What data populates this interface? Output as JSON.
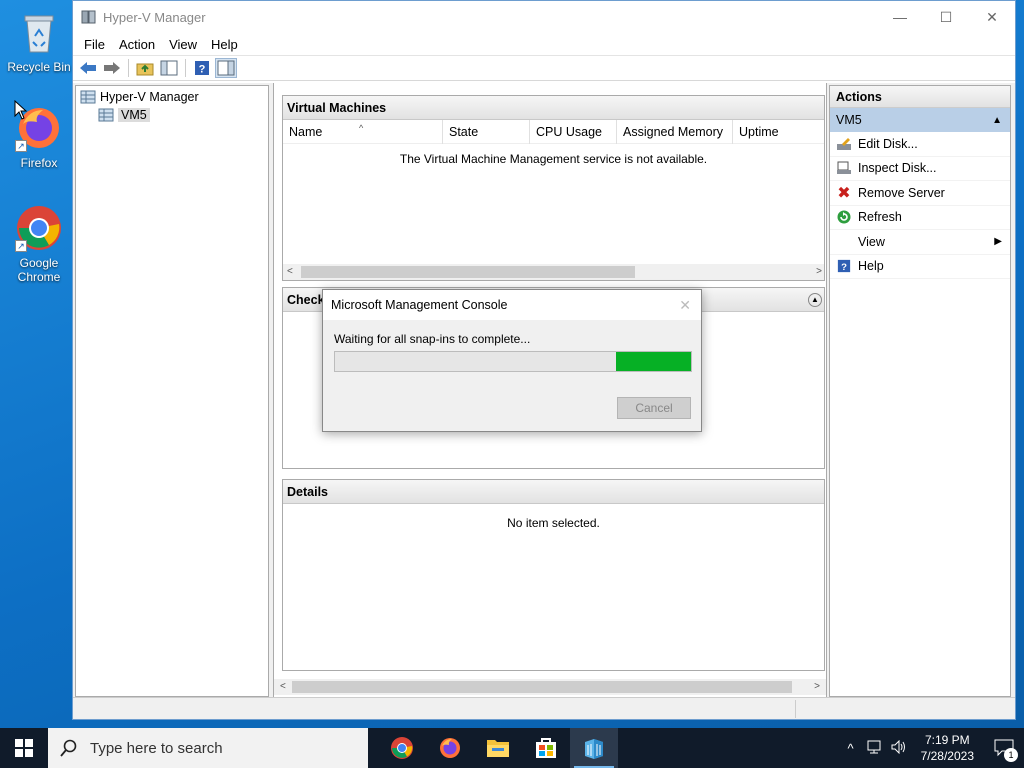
{
  "desktop": {
    "icons": [
      {
        "label": "Recycle Bin"
      },
      {
        "label": "Firefox"
      },
      {
        "label": "Google Chrome"
      }
    ]
  },
  "window": {
    "title": "Hyper-V Manager",
    "menu": [
      "File",
      "Action",
      "View",
      "Help"
    ],
    "tree": {
      "root": "Hyper-V Manager",
      "child": "VM5"
    },
    "vm_pane": {
      "title": "Virtual Machines",
      "columns": [
        "Name",
        "State",
        "CPU Usage",
        "Assigned Memory",
        "Uptime"
      ],
      "message": "The Virtual Machine Management service is not available."
    },
    "checkpoints_pane": {
      "title": "Checkp"
    },
    "details_pane": {
      "title": "Details",
      "message": "No item selected."
    },
    "actions": {
      "title": "Actions",
      "section": "VM5",
      "items": [
        {
          "label": "Edit Disk...",
          "icon": "edit-disk-icon"
        },
        {
          "label": "Inspect Disk...",
          "icon": "inspect-disk-icon"
        },
        {
          "label": "Remove Server",
          "icon": "remove-icon"
        },
        {
          "label": "Refresh",
          "icon": "refresh-icon"
        },
        {
          "label": "View",
          "icon": "none"
        },
        {
          "label": "Help",
          "icon": "help-icon"
        }
      ]
    }
  },
  "dialog": {
    "title": "Microsoft Management Console",
    "message": "Waiting for all snap-ins to complete...",
    "progress_fill": {
      "start": 0.79,
      "end": 1.0
    },
    "cancel_label": "Cancel"
  },
  "taskbar": {
    "search_placeholder": "Type here to search",
    "time": "7:19 PM",
    "date": "7/28/2023",
    "notification_count": "1"
  },
  "colors": {
    "progress": "#06b025",
    "selection": "#b9cfe7",
    "desktop": "#1677c9",
    "taskbar": "#101b2a"
  }
}
